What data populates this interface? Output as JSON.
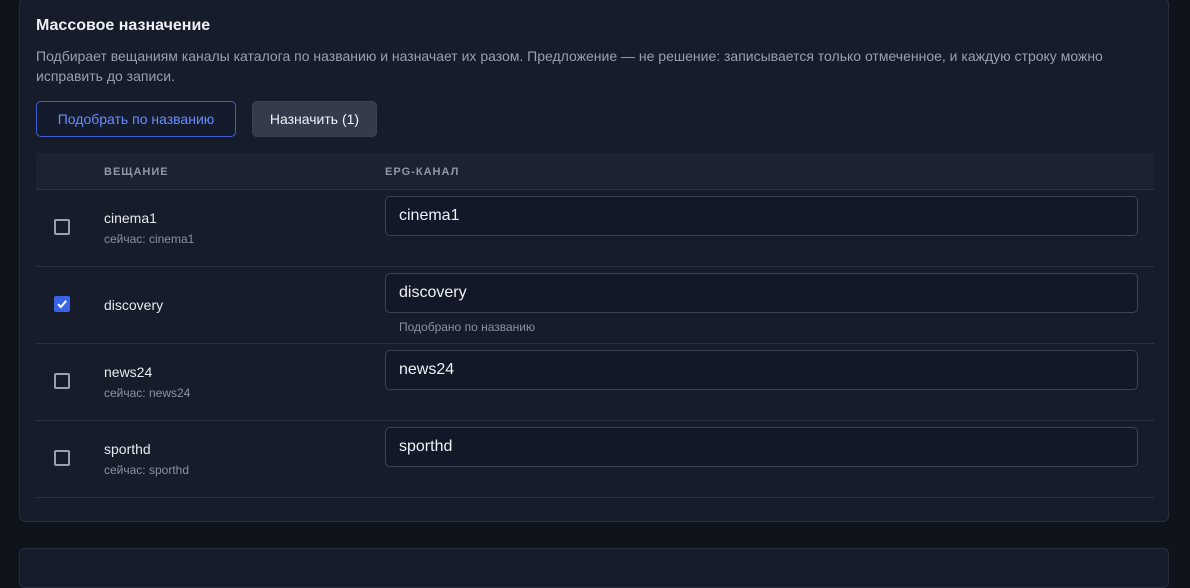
{
  "panel": {
    "title": "Массовое назначение",
    "description": "Подбирает вещаниям каналы каталога по названию и назначает их разом. Предложение — не решение: записывается только отмеченное, и каждую строку можно исправить до записи.",
    "match_button": "Подобрать по названию",
    "assign_button": "Назначить (1)"
  },
  "table": {
    "headers": {
      "broadcast": "ВЕЩАНИЕ",
      "epg": "EPG-КАНАЛ"
    },
    "rows": [
      {
        "name": "cinema1",
        "current": "сейчас: cinema1",
        "epg": "cinema1",
        "checked": false,
        "hint": ""
      },
      {
        "name": "discovery",
        "current": "",
        "epg": "discovery",
        "checked": true,
        "hint": "Подобрано по названию"
      },
      {
        "name": "news24",
        "current": "сейчас: news24",
        "epg": "news24",
        "checked": false,
        "hint": ""
      },
      {
        "name": "sporthd",
        "current": "сейчас: sporthd",
        "epg": "sporthd",
        "checked": false,
        "hint": ""
      }
    ]
  },
  "colors": {
    "accent": "#3b63e6",
    "link": "#6b8cff",
    "background": "#0e131c",
    "card": "#161c29"
  }
}
